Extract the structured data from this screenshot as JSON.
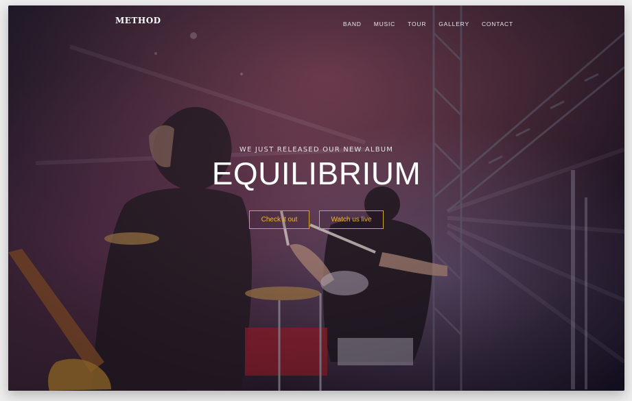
{
  "nav": {
    "logo": "METHOD",
    "items": [
      {
        "label": "BAND"
      },
      {
        "label": "MUSIC"
      },
      {
        "label": "TOUR"
      },
      {
        "label": "GALLERY"
      },
      {
        "label": "CONTACT"
      }
    ]
  },
  "hero": {
    "kicker": "WE JUST RELEASED OUR NEW ALBUM",
    "title": "EQUILIBRIUM",
    "buttons": {
      "primary_label": "Check it out",
      "secondary_label": "Watch us live"
    }
  },
  "colors": {
    "accent": "#f0b72a",
    "text": "#ffffff"
  }
}
